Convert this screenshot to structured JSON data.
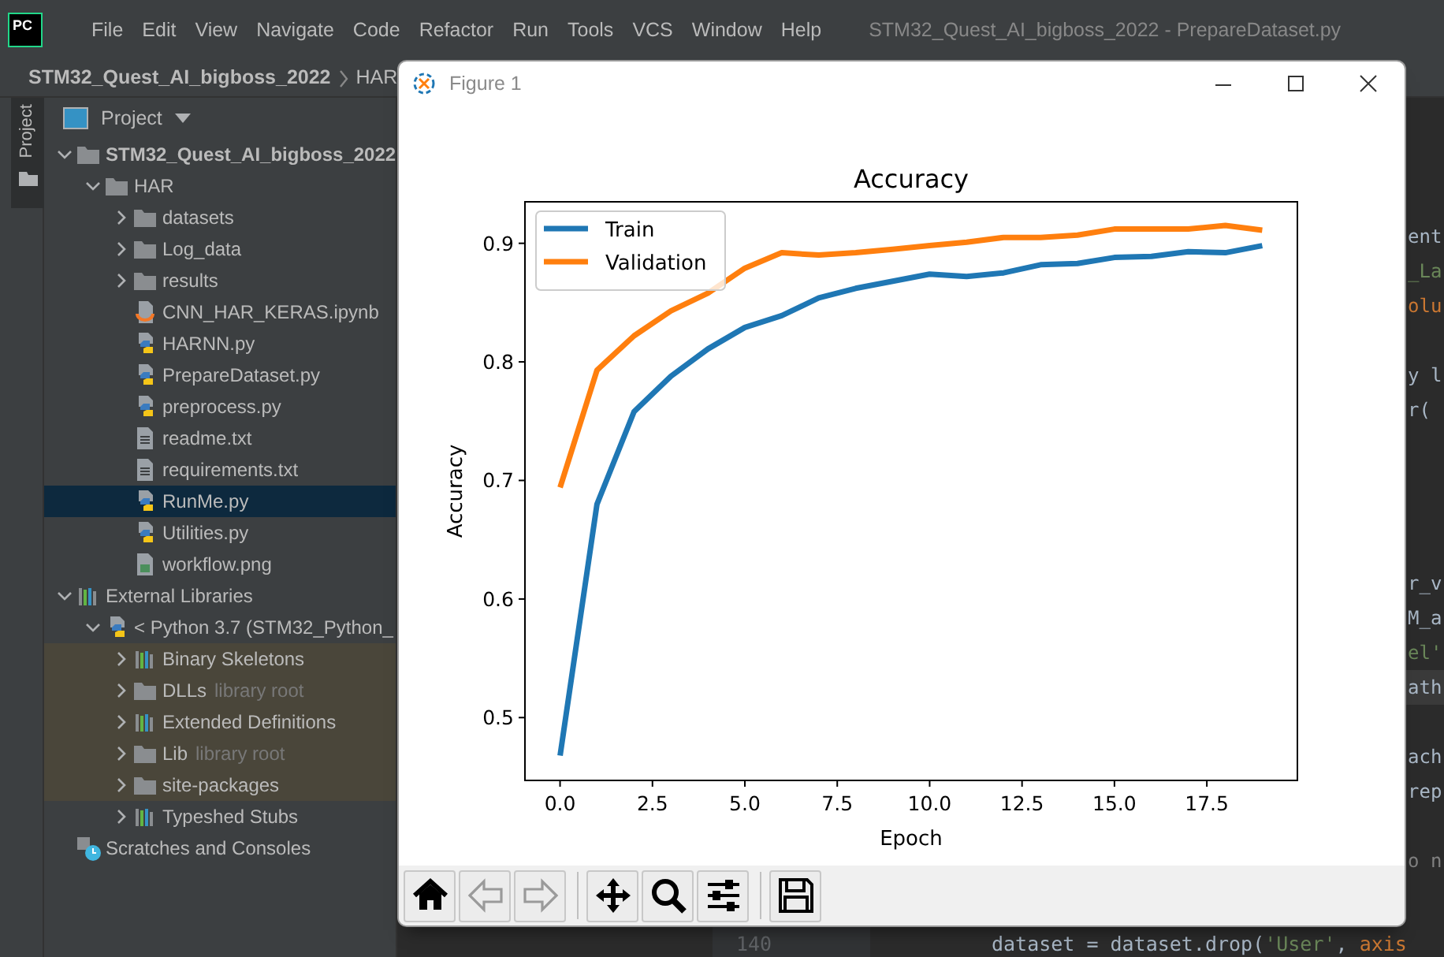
{
  "menu_bar": {
    "logo": "PC",
    "items": [
      "File",
      "Edit",
      "View",
      "Navigate",
      "Code",
      "Refactor",
      "Run",
      "Tools",
      "VCS",
      "Window",
      "Help"
    ],
    "window_title": "STM32_Quest_AI_bigboss_2022 - PrepareDataset.py"
  },
  "breadcrumb": [
    "STM32_Quest_AI_bigboss_2022",
    "HAR"
  ],
  "tool_strip": {
    "label": "Project"
  },
  "project_panel": {
    "title": "Project",
    "tree": [
      {
        "label": "STM32_Quest_AI_bigboss_2022",
        "kind": "folder",
        "bold": true,
        "expanded": true,
        "selected": false,
        "children": [
          {
            "label": "HAR",
            "kind": "folder",
            "expanded": true,
            "selected": false,
            "children": [
              {
                "label": "datasets",
                "kind": "folder",
                "expanded": false,
                "selected": false
              },
              {
                "label": "Log_data",
                "kind": "folder",
                "expanded": false,
                "selected": false
              },
              {
                "label": "results",
                "kind": "folder",
                "expanded": false,
                "selected": false
              },
              {
                "label": "CNN_HAR_KERAS.ipynb",
                "kind": "notebook",
                "selected": false
              },
              {
                "label": "HARNN.py",
                "kind": "python",
                "selected": false
              },
              {
                "label": "PrepareDataset.py",
                "kind": "python",
                "selected": false
              },
              {
                "label": "preprocess.py",
                "kind": "python",
                "selected": false
              },
              {
                "label": "readme.txt",
                "kind": "text",
                "selected": false
              },
              {
                "label": "requirements.txt",
                "kind": "text",
                "selected": false
              },
              {
                "label": "RunMe.py",
                "kind": "python",
                "selected": true
              },
              {
                "label": "Utilities.py",
                "kind": "python",
                "selected": false
              },
              {
                "label": "workflow.png",
                "kind": "image",
                "selected": false
              }
            ]
          }
        ]
      },
      {
        "label": "External Libraries",
        "kind": "library",
        "bold": false,
        "expanded": true,
        "selected": false,
        "children": [
          {
            "label": "< Python 3.7 (STM32_Python_",
            "kind": "python",
            "expanded": true,
            "selected": false,
            "children": [
              {
                "label": "Binary Skeletons",
                "kind": "library",
                "expanded": false,
                "selected": false,
                "highlighted": true
              },
              {
                "label": "DLLs",
                "hint": "library root",
                "kind": "folder",
                "expanded": false,
                "selected": false,
                "highlighted": true
              },
              {
                "label": "Extended Definitions",
                "kind": "library",
                "expanded": false,
                "selected": false,
                "highlighted": true
              },
              {
                "label": "Lib",
                "hint": "library root",
                "kind": "folder",
                "expanded": false,
                "selected": false,
                "highlighted": true
              },
              {
                "label": "site-packages",
                "kind": "folder",
                "expanded": false,
                "selected": false,
                "highlighted": true
              },
              {
                "label": "Typeshed Stubs",
                "kind": "library",
                "expanded": false,
                "selected": false,
                "highlighted": false
              }
            ]
          }
        ]
      },
      {
        "label": "Scratches and Consoles",
        "kind": "scratches",
        "bold": false,
        "selected": false
      }
    ]
  },
  "editor": {
    "lines": [
      {
        "kind": "plain",
        "text": "ent",
        "current": false
      },
      {
        "kind": "string",
        "text": "_La",
        "current": false
      },
      {
        "kind": "keyword",
        "text": "olu",
        "current": false
      },
      {
        "kind": "plain",
        "text": "y l",
        "current": false
      },
      {
        "kind": "plain",
        "text": "r(",
        "current": false
      },
      {
        "kind": "plain",
        "text": "r_v",
        "current": false
      },
      {
        "kind": "plain",
        "text": "M_a",
        "current": false
      },
      {
        "kind": "string",
        "text": "el'",
        "current": false
      },
      {
        "kind": "plain",
        "text": "ath",
        "current": true
      },
      {
        "kind": "plain",
        "text": "ach",
        "current": false
      },
      {
        "kind": "plain",
        "text": "rep",
        "current": false
      },
      {
        "kind": "comment",
        "text": "o n",
        "current": false
      },
      {
        "kind": "code",
        "line_number": "140",
        "current": false,
        "tokens": [
          {
            "kind": "plain",
            "text": "dataset = dataset.drop("
          },
          {
            "kind": "string",
            "text": "'User'"
          },
          {
            "kind": "plain",
            "text": ", "
          },
          {
            "kind": "keyword",
            "text": "axis"
          }
        ]
      }
    ]
  },
  "figure_window": {
    "title": "Figure 1",
    "chart_data": {
      "type": "line",
      "title": "Accuracy",
      "legend": "upper left",
      "xlabel": "Epoch",
      "ylabel": "Accuracy",
      "x": [
        0,
        1,
        2,
        3,
        4,
        5,
        6,
        7,
        8,
        9,
        10,
        11,
        12,
        13,
        14,
        15,
        16,
        17,
        18,
        19
      ],
      "xlim": [
        -0.95,
        19.95
      ],
      "ylim": [
        0.447,
        0.935
      ],
      "xticks": [
        {
          "value": 0,
          "label": "0.0"
        },
        {
          "value": 2.5,
          "label": "2.5"
        },
        {
          "value": 5,
          "label": "5.0"
        },
        {
          "value": 7.5,
          "label": "7.5"
        },
        {
          "value": 10,
          "label": "10.0"
        },
        {
          "value": 12.5,
          "label": "12.5"
        },
        {
          "value": 15,
          "label": "15.0"
        },
        {
          "value": 17.5,
          "label": "17.5"
        }
      ],
      "yticks": [
        0.5,
        0.6,
        0.7,
        0.8,
        0.9
      ],
      "series": [
        {
          "name": "Train",
          "color": "#1f77b4",
          "values": [
            0.468,
            0.68,
            0.758,
            0.788,
            0.811,
            0.829,
            0.839,
            0.854,
            0.862,
            0.868,
            0.874,
            0.872,
            0.875,
            0.882,
            0.883,
            0.888,
            0.889,
            0.893,
            0.892,
            0.898
          ]
        },
        {
          "name": "Validation",
          "color": "#ff7f0e",
          "values": [
            0.694,
            0.793,
            0.822,
            0.843,
            0.858,
            0.879,
            0.892,
            0.89,
            0.892,
            0.895,
            0.898,
            0.901,
            0.905,
            0.905,
            0.907,
            0.912,
            0.912,
            0.912,
            0.915,
            0.911
          ]
        }
      ]
    },
    "toolbar": [
      {
        "kind": "home",
        "disabled": false
      },
      {
        "kind": "back",
        "disabled": true
      },
      {
        "kind": "forward",
        "disabled": true
      },
      {
        "kind": "separator"
      },
      {
        "kind": "pan",
        "disabled": false
      },
      {
        "kind": "zoom",
        "disabled": false
      },
      {
        "kind": "configure",
        "disabled": false
      },
      {
        "kind": "separator"
      },
      {
        "kind": "save",
        "disabled": false
      }
    ]
  }
}
